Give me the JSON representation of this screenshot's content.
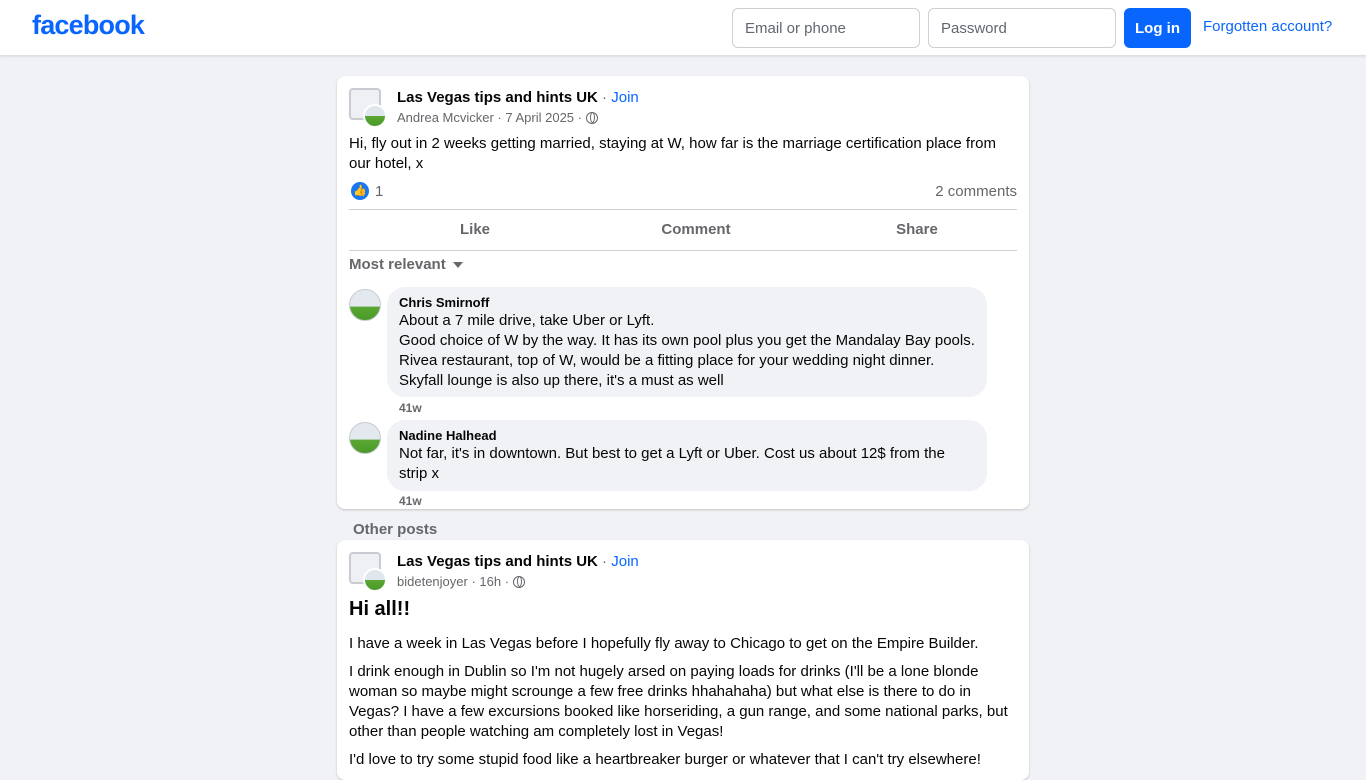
{
  "header": {
    "logo": "facebook",
    "email_placeholder": "Email or phone",
    "password_placeholder": "Password",
    "login_label": "Log in",
    "forgot_label": "Forgotten account?"
  },
  "post": {
    "group": "Las Vegas tips and hints UK",
    "join_label": "Join",
    "author": "Andrea Mcvicker",
    "date": "7 April 2025",
    "text": "Hi, fly out in 2 weeks getting married,  staying at W, how far is the marriage certification place from our hotel, x",
    "like_count": "1",
    "comments_count": "2 comments",
    "actions": {
      "like": "Like",
      "comment": "Comment",
      "share": "Share"
    },
    "sort_label": "Most relevant",
    "comments": [
      {
        "name": "Chris Smirnoff",
        "lines": [
          "About a 7 mile drive, take Uber or Lyft.",
          "Good choice of W by the way. It has its own pool plus you get the Mandalay Bay pools.",
          "Rivea restaurant, top of W, would be a fitting place for your wedding night dinner.",
          "Skyfall lounge is also up there, it's a must as well"
        ],
        "time": "41w"
      },
      {
        "name": "Nadine Halhead",
        "lines": [
          "Not far, it's in downtown. But best to get a Lyft or Uber. Cost us about 12$ from the",
          "strip x"
        ],
        "time": "41w"
      }
    ]
  },
  "other_posts_label": "Other posts",
  "post2": {
    "group": "Las Vegas tips and hints UK",
    "join_label": "Join",
    "author": "bidetenjoyer",
    "date": "16h",
    "title": "Hi all!!",
    "paragraphs": [
      "I have a week in Las Vegas before I hopefully fly away to Chicago to get on the Empire Builder.",
      "I drink enough in Dublin so I'm not hugely arsed on paying loads for drinks (I'll be a lone blonde woman so maybe might scrounge a few free drinks hhahahaha) but what else is there to do in Vegas? I have a few excursions booked like horseriding, a gun range, and some national parks, but other than people watching am completely lost in Vegas!",
      "I'd love to try some stupid food like a heartbreaker burger or whatever that I can't try elsewhere!"
    ]
  }
}
